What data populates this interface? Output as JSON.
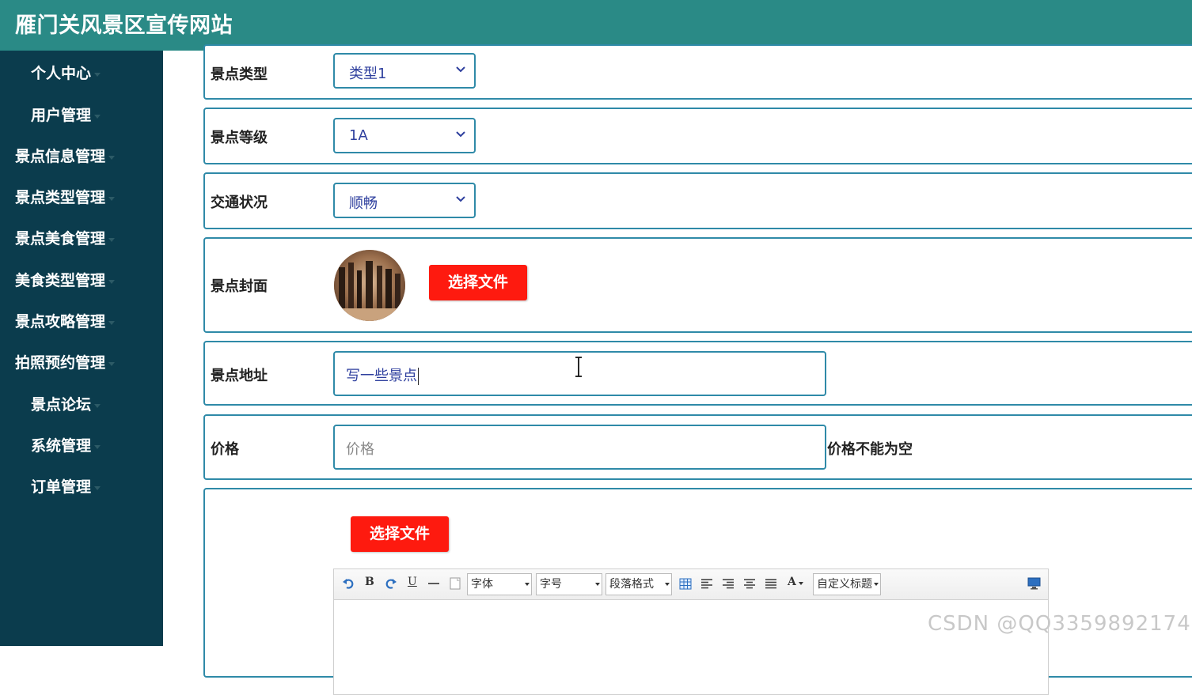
{
  "app": {
    "title": "雁门关风景区宣传网站"
  },
  "sidebar": {
    "items": [
      {
        "label": "个人中心"
      },
      {
        "label": "用户管理"
      },
      {
        "label": "景点信息管理"
      },
      {
        "label": "景点类型管理"
      },
      {
        "label": "景点美食管理"
      },
      {
        "label": "美食类型管理"
      },
      {
        "label": "景点攻略管理"
      },
      {
        "label": "拍照预约管理"
      },
      {
        "label": "景点论坛"
      },
      {
        "label": "系统管理"
      },
      {
        "label": "订单管理"
      }
    ]
  },
  "form": {
    "type": {
      "label": "景点类型",
      "value": "类型1"
    },
    "level": {
      "label": "景点等级",
      "value": "1A"
    },
    "traffic": {
      "label": "交通状况",
      "value": "顺畅"
    },
    "cover": {
      "label": "景点封面",
      "button": "选择文件"
    },
    "address": {
      "label": "景点地址",
      "value": "写一些景点"
    },
    "price": {
      "label": "价格",
      "placeholder": "价格",
      "error": "价格不能为空"
    },
    "detail": {
      "button": "选择文件"
    }
  },
  "editor": {
    "font": "字体",
    "size": "字号",
    "paragraph": "段落格式",
    "custom_title": "自定义标题",
    "buttons": {
      "bold": "B",
      "underline": "U",
      "font_color": "A"
    }
  },
  "watermark": "CSDN @QQ3359892174"
}
